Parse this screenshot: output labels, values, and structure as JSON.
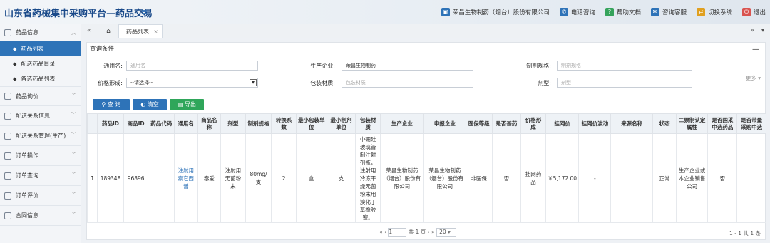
{
  "header": {
    "title": "山东省药械集中采购平台—药品交易",
    "menu_toggle": "≡",
    "nav": [
      {
        "label": "荣昌生物制药（烟台）股份有限公司",
        "icon": "building-icon",
        "color": "#2e73b8"
      },
      {
        "label": "电话咨询",
        "icon": "phone-icon",
        "color": "#2e73b8"
      },
      {
        "label": "帮助文档",
        "icon": "help-icon",
        "color": "#35a35b"
      },
      {
        "label": "咨询客服",
        "icon": "chat-icon",
        "color": "#2e73b8"
      },
      {
        "label": "切换系统",
        "icon": "switch-icon",
        "color": "#e0a020"
      },
      {
        "label": "退出",
        "icon": "exit-icon",
        "color": "#d9534f"
      }
    ]
  },
  "sidebar": {
    "groups": [
      {
        "label": "药品信息",
        "items": [
          "药品列表",
          "配送药品目录",
          "备选药品列表"
        ],
        "active": 0
      },
      {
        "label": "药品询价"
      },
      {
        "label": "配送关系信息"
      },
      {
        "label": "配送关系管理(生产)"
      },
      {
        "label": "订单操作"
      },
      {
        "label": "订单查询"
      },
      {
        "label": "订单评价"
      },
      {
        "label": "合同信息"
      }
    ]
  },
  "tabs": {
    "home": "⌂",
    "active": "药品列表",
    "close": "×"
  },
  "query": {
    "title": "查询条件",
    "more": "更多",
    "fields": {
      "generic_name": {
        "label": "通用名:",
        "placeholder": "通用名"
      },
      "manufacturer": {
        "label": "生产企业:",
        "value": "荣昌生物制药"
      },
      "spec": {
        "label": "制剂规格:",
        "placeholder": "制剂规格"
      },
      "price_form": {
        "label": "价格形成:",
        "value": "--请选择--"
      },
      "package_material": {
        "label": "包装材质:",
        "placeholder": "包装材质"
      },
      "dosage_form": {
        "label": "剂型:",
        "placeholder": "剂型"
      }
    },
    "buttons": {
      "search": "查 询",
      "clear": "清空",
      "export": "导出"
    },
    "colors": {
      "search": "#2e73b8",
      "clear": "#2e73b8",
      "export": "#2fa65a"
    }
  },
  "table": {
    "headers": [
      "",
      "药品ID",
      "商品ID",
      "药品代码",
      "通用名",
      "商品名称",
      "剂型",
      "制剂规格",
      "转换系数",
      "最小包装单位",
      "最小制剂单位",
      "包装材质",
      "生产企业",
      "申报企业",
      "医保等级",
      "是否基药",
      "价格形成",
      "挂网价",
      "挂网价波动",
      "来源名称",
      "状态",
      "二票制认定属性",
      "是否国采中选药品",
      "是否带量采购中选"
    ],
    "rows": [
      [
        "1",
        "189348",
        "96896",
        "",
        "注射用泰它西普",
        "泰爱",
        "注射用无菌粉末",
        "80mg/支",
        "2",
        "盒",
        "支",
        "中硼硅玻璃管制注射剂瓶，注射用冷冻干燥无菌粉末用溴化丁基橡胶塞。",
        "荣昌生物制药（烟台）股份有限公司",
        "荣昌生物制药（烟台）股份有限公司",
        "非医保",
        "否",
        "挂网药品",
        "￥5,172.00",
        "-",
        "",
        "正常",
        "生产企业或本企业销售公司",
        "否",
        ""
      ]
    ]
  },
  "pager": {
    "first": "«",
    "prev": "‹",
    "page": "1",
    "of": "共 1 页",
    "next": "›",
    "last": "»",
    "page_size": "20",
    "info": "1 - 1   共 1 条"
  }
}
